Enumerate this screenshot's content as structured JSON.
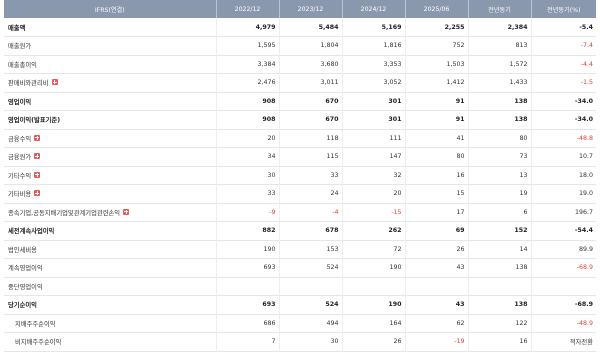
{
  "header": [
    "IFRS(연결)",
    "2022/12",
    "2023/12",
    "2024/12",
    "2025/06",
    "전년동기",
    "전년동기(%)"
  ],
  "colors": {
    "header_bg": "#8a98ad",
    "negative": "#e0413b",
    "expand_icon": "#e85a5a"
  },
  "rows": [
    {
      "label": "매출액",
      "bold": true,
      "sub": false,
      "expand": false,
      "values": [
        "4,979",
        "5,484",
        "5,169",
        "2,255",
        "2,384",
        "-5.4"
      ],
      "neg": [
        false,
        false,
        false,
        false,
        false,
        true
      ]
    },
    {
      "label": "매출원가",
      "bold": false,
      "sub": false,
      "expand": false,
      "values": [
        "1,595",
        "1,804",
        "1,816",
        "752",
        "813",
        "-7.4"
      ],
      "neg": [
        false,
        false,
        false,
        false,
        false,
        true
      ]
    },
    {
      "label": "매출총이익",
      "bold": false,
      "sub": false,
      "expand": false,
      "values": [
        "3,384",
        "3,680",
        "3,353",
        "1,503",
        "1,572",
        "-4.4"
      ],
      "neg": [
        false,
        false,
        false,
        false,
        false,
        true
      ]
    },
    {
      "label": "판매비와관리비",
      "bold": false,
      "sub": false,
      "expand": true,
      "values": [
        "2,476",
        "3,011",
        "3,052",
        "1,412",
        "1,433",
        "-1.5"
      ],
      "neg": [
        false,
        false,
        false,
        false,
        false,
        true
      ]
    },
    {
      "label": "영업이익",
      "bold": true,
      "sub": false,
      "expand": false,
      "values": [
        "908",
        "670",
        "301",
        "91",
        "138",
        "-34.0"
      ],
      "neg": [
        false,
        false,
        false,
        false,
        false,
        true
      ]
    },
    {
      "label": "영업이익(발표기준)",
      "bold": true,
      "sub": false,
      "expand": false,
      "values": [
        "908",
        "670",
        "301",
        "91",
        "138",
        "-34.0"
      ],
      "neg": [
        false,
        false,
        false,
        false,
        false,
        true
      ]
    },
    {
      "label": "금융수익",
      "bold": false,
      "sub": false,
      "expand": true,
      "values": [
        "20",
        "118",
        "111",
        "41",
        "80",
        "-48.8"
      ],
      "neg": [
        false,
        false,
        false,
        false,
        false,
        true
      ]
    },
    {
      "label": "금융원가",
      "bold": false,
      "sub": false,
      "expand": true,
      "values": [
        "34",
        "115",
        "147",
        "80",
        "73",
        "10.7"
      ],
      "neg": [
        false,
        false,
        false,
        false,
        false,
        false
      ]
    },
    {
      "label": "기타수익",
      "bold": false,
      "sub": false,
      "expand": true,
      "values": [
        "30",
        "33",
        "32",
        "16",
        "13",
        "18.0"
      ],
      "neg": [
        false,
        false,
        false,
        false,
        false,
        false
      ]
    },
    {
      "label": "기타비용",
      "bold": false,
      "sub": false,
      "expand": true,
      "values": [
        "33",
        "24",
        "20",
        "15",
        "19",
        "19.0"
      ],
      "neg": [
        false,
        false,
        false,
        false,
        false,
        false
      ]
    },
    {
      "label": "종속기업,공동지배기업및관계기업관련손익",
      "bold": false,
      "sub": false,
      "expand": true,
      "values": [
        "-9",
        "-4",
        "-15",
        "17",
        "6",
        "196.7"
      ],
      "neg": [
        true,
        true,
        true,
        false,
        false,
        false
      ]
    },
    {
      "label": "세전계속사업이익",
      "bold": true,
      "sub": false,
      "expand": false,
      "values": [
        "882",
        "678",
        "262",
        "69",
        "152",
        "-54.4"
      ],
      "neg": [
        false,
        false,
        false,
        false,
        false,
        true
      ]
    },
    {
      "label": "법인세비용",
      "bold": false,
      "sub": false,
      "expand": false,
      "values": [
        "190",
        "153",
        "72",
        "26",
        "14",
        "89.9"
      ],
      "neg": [
        false,
        false,
        false,
        false,
        false,
        false
      ]
    },
    {
      "label": "계속영업이익",
      "bold": false,
      "sub": false,
      "expand": false,
      "values": [
        "693",
        "524",
        "190",
        "43",
        "138",
        "-68.9"
      ],
      "neg": [
        false,
        false,
        false,
        false,
        false,
        true
      ]
    },
    {
      "label": "중단영업이익",
      "bold": false,
      "sub": false,
      "expand": false,
      "values": [
        "",
        "",
        "",
        "",
        "",
        ""
      ],
      "neg": [
        false,
        false,
        false,
        false,
        false,
        false
      ]
    },
    {
      "label": "당기순이익",
      "bold": true,
      "sub": false,
      "expand": false,
      "values": [
        "693",
        "524",
        "190",
        "43",
        "138",
        "-68.9"
      ],
      "neg": [
        false,
        false,
        false,
        false,
        false,
        true
      ]
    },
    {
      "label": "지배주주순이익",
      "bold": false,
      "sub": true,
      "expand": false,
      "values": [
        "686",
        "494",
        "164",
        "62",
        "122",
        "-48.9"
      ],
      "neg": [
        false,
        false,
        false,
        false,
        false,
        true
      ]
    },
    {
      "label": "비지배주주순이익",
      "bold": false,
      "sub": true,
      "expand": false,
      "values": [
        "7",
        "30",
        "26",
        "-19",
        "16",
        "적자전환"
      ],
      "neg": [
        false,
        false,
        false,
        true,
        false,
        false
      ]
    }
  ]
}
